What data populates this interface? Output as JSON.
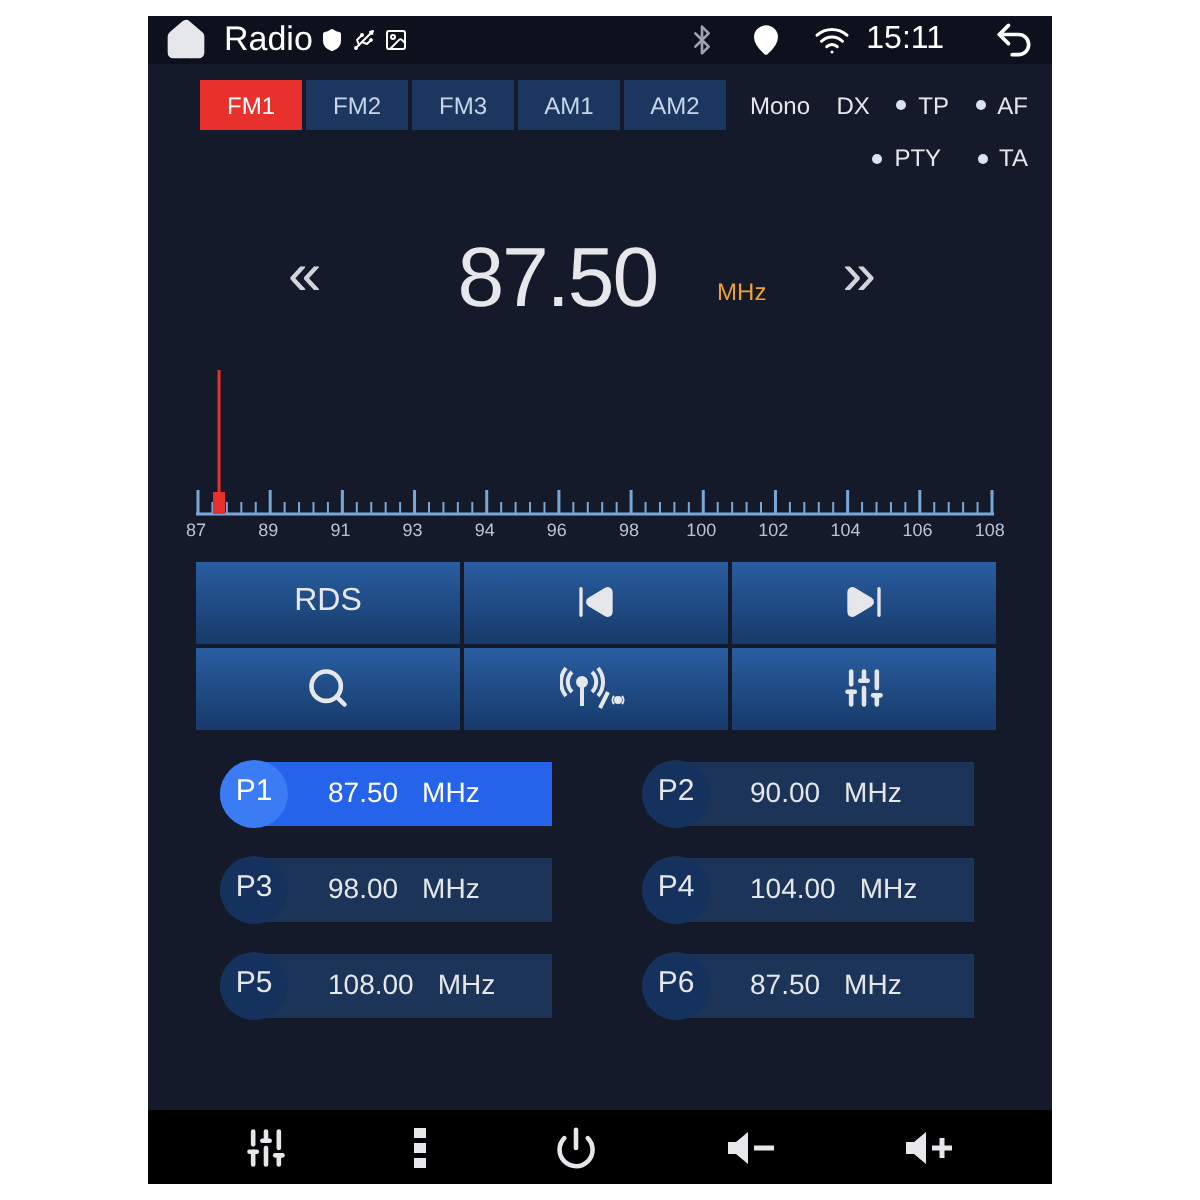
{
  "status_bar": {
    "title": "Radio",
    "time": "15:11"
  },
  "bands": [
    {
      "label": "FM1",
      "selected": true
    },
    {
      "label": "FM2",
      "selected": false
    },
    {
      "label": "FM3",
      "selected": false
    },
    {
      "label": "AM1",
      "selected": false
    },
    {
      "label": "AM2",
      "selected": false
    }
  ],
  "options": [
    [
      {
        "label": "Mono",
        "kind": "text"
      },
      {
        "label": "DX",
        "kind": "text"
      },
      {
        "label": "TP",
        "kind": "dot"
      },
      {
        "label": "AF",
        "kind": "dot"
      }
    ],
    [
      {
        "label": "PTY",
        "kind": "dot"
      },
      {
        "label": "TA",
        "kind": "dot"
      }
    ]
  ],
  "frequency": {
    "prev": "«",
    "value": "87.50",
    "unit": "MHz",
    "next": "»"
  },
  "scale": {
    "labels": [
      "87",
      "89",
      "91",
      "93",
      "94",
      "96",
      "98",
      "100",
      "102",
      "104",
      "106",
      "108"
    ],
    "level": 0.024
  },
  "controls": [
    {
      "kind": "text",
      "label": "RDS"
    },
    {
      "kind": "prev"
    },
    {
      "kind": "next"
    },
    {
      "kind": "search"
    },
    {
      "kind": "signal"
    },
    {
      "kind": "equalizer"
    }
  ],
  "presets": [
    {
      "label": "P1",
      "frequency": "87.50",
      "unit": "MHz",
      "selected": true
    },
    {
      "label": "P2",
      "frequency": "90.00",
      "unit": "MHz",
      "selected": false
    },
    {
      "label": "P3",
      "frequency": "98.00",
      "unit": "MHz",
      "selected": false
    },
    {
      "label": "P4",
      "frequency": "104.00",
      "unit": "MHz",
      "selected": false
    },
    {
      "label": "P5",
      "frequency": "108.00",
      "unit": "MHz",
      "selected": false
    },
    {
      "label": "P6",
      "frequency": "87.50",
      "unit": "MHz",
      "selected": false
    }
  ],
  "bottom_bar": [
    {
      "kind": "equalizer"
    },
    {
      "kind": "menu"
    },
    {
      "kind": "power"
    },
    {
      "kind": "volume_down"
    },
    {
      "kind": "volume_up"
    }
  ]
}
